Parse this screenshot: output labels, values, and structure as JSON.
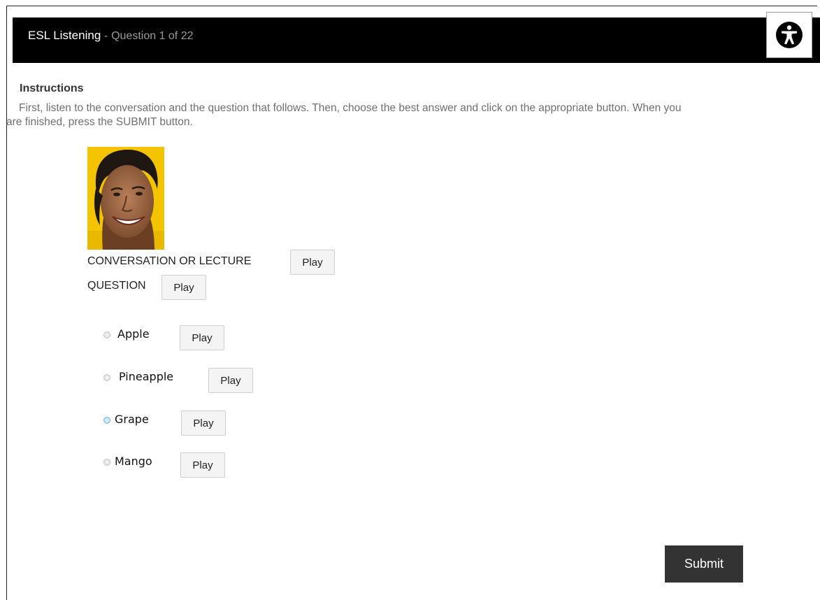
{
  "header": {
    "app_title": "ESL Listening",
    "separator": "-",
    "progress": "Question 1 of 22"
  },
  "accessibility": {
    "icon": "accessibility-person-icon"
  },
  "instructions": {
    "heading": "Instructions",
    "line1": "First, listen to the conversation and the question that follows. Then, choose the best answer and click on the appropriate button. When you",
    "line2": "are finished, press the SUBMIT button."
  },
  "media": {
    "avatar": "speaker-photo",
    "conversation_label": "CONVERSATION OR LECTURE",
    "conversation_button": "Play",
    "question_label": "QUESTION",
    "question_button": "Play"
  },
  "options": [
    {
      "label": "Apple",
      "button": "Play",
      "selected": false
    },
    {
      "label": "Pineapple",
      "button": "Play",
      "selected": false
    },
    {
      "label": "Grape",
      "button": "Play",
      "selected": true
    },
    {
      "label": "Mango",
      "button": "Play",
      "selected": false
    }
  ],
  "submit": {
    "label": "Submit"
  },
  "colors": {
    "header_bg": "#000000",
    "submit_bg": "#333333",
    "selected_radio": "#a7d1f2",
    "avatar_bg": "#f5c400"
  }
}
